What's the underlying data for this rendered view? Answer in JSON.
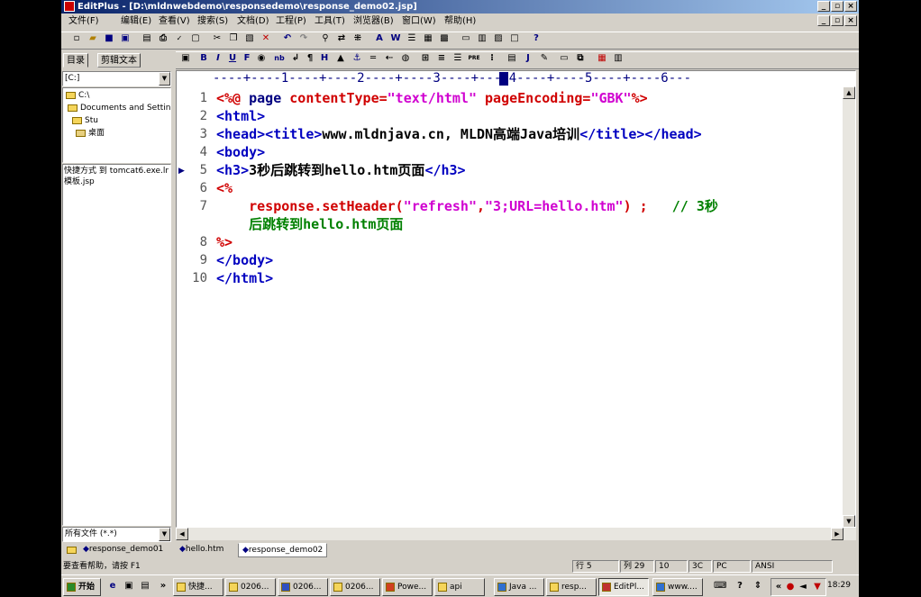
{
  "window": {
    "title": "EditPlus - [D:\\mldnwebdemo\\responsedemo\\response_demo02.jsp]"
  },
  "menu": [
    "文件(F)",
    "编辑(E)",
    "查看(V)",
    "搜索(S)",
    "文档(D)",
    "工程(P)",
    "工具(T)",
    "浏览器(B)",
    "窗口(W)",
    "帮助(H)"
  ],
  "left_panel": {
    "tabs": [
      "目录",
      "剪辑文本"
    ],
    "drive": "[C:]",
    "tree": [
      "C:\\",
      "Documents and Settings",
      "Stu",
      "桌面"
    ],
    "files": [
      "快捷方式 到 tomcat6.exe.lr",
      "模板.jsp"
    ],
    "filter": "所有文件 (*.*)"
  },
  "ruler": "----+----1----+----2----+----3----+----4----+----5----+----6---",
  "editor": {
    "line_numbers": [
      "1",
      "2",
      "3",
      "4",
      "5",
      "6",
      "7",
      "",
      "8",
      "9",
      "10"
    ],
    "lines": {
      "l1a": "<%@ ",
      "l1b": "page ",
      "l1c": "contentType=",
      "l1d": "\"text/html\"",
      "l1e": " pageEncoding=",
      "l1f": "\"GBK\"",
      "l1g": "%>",
      "l2": "<html>",
      "l3a": "<head><title>",
      "l3b": "www.mldnjava.cn, MLDN高端Java培训",
      "l3c": "</title></head>",
      "l4": "<body>",
      "l5a": "<h3>",
      "l5b": "3秒后跳转到hello.htm页面",
      "l5c": "</h3>",
      "l6": "<%",
      "l7a": "    response.setHeader(",
      "l7b": "\"refresh\"",
      "l7c": ",",
      "l7d": "\"3;URL=hello.htm\"",
      "l7e": ") ;   ",
      "l7f": "// 3秒",
      "l7g": "    后跳转到hello.htm页面",
      "l8": "%>",
      "l9": "</body>",
      "l10": "</html>"
    }
  },
  "doc_tabs": [
    "response_demo01",
    "hello.htm",
    "response_demo02"
  ],
  "status": {
    "help": "要查看帮助，请按 F1",
    "line": "行 5",
    "col": "列 29",
    "num": "10",
    "hex": "3C",
    "mode": "PC",
    "enc": "ANSI"
  },
  "taskbar": {
    "start": "开始",
    "tasks": [
      "快捷...",
      "0206...",
      "0206...",
      "0206...",
      "Powe...",
      "api",
      "Java ...",
      "resp...",
      "EditPl...",
      "www...."
    ],
    "clock": "18:29"
  }
}
